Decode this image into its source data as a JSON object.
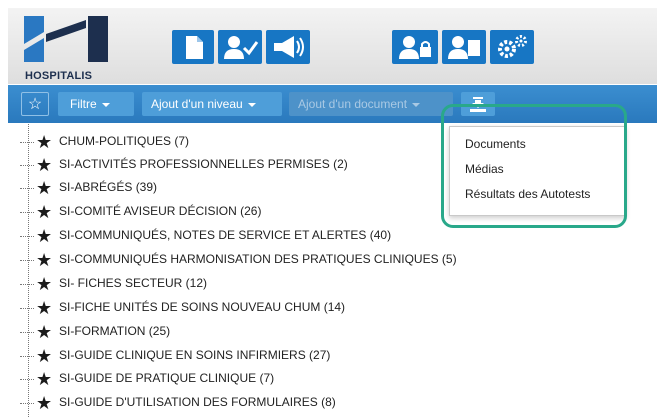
{
  "header": {
    "logo_text": "HOSPITALIS",
    "toolbar_icons": [
      {
        "name": "document-icon"
      },
      {
        "name": "user-check-icon"
      },
      {
        "name": "megaphone-icon"
      },
      {
        "name": "user-lock-icon"
      },
      {
        "name": "user-card-icon"
      },
      {
        "name": "settings-gears-icon"
      }
    ]
  },
  "toolbar": {
    "star_icon": "☆",
    "filter_label": "Filtre",
    "add_level_label": "Ajout d'un niveau",
    "add_document_label": "Ajout d'un document",
    "export_icon": "download-icon"
  },
  "tree": {
    "items": [
      {
        "label": "CHUM-POLITIQUES (7)"
      },
      {
        "label": "SI-ACTIVITÉS PROFESSIONNELLES PERMISES (2)"
      },
      {
        "label": "SI-ABRÉGÉS (39)"
      },
      {
        "label": "SI-COMITÉ AVISEUR DÉCISION (26)"
      },
      {
        "label": "SI-COMMUNIQUÉS, NOTES DE SERVICE ET ALERTES (40)"
      },
      {
        "label": "SI-COMMUNIQUÉS HARMONISATION DES PRATIQUES CLINIQUES (5)"
      },
      {
        "label": "SI- FICHES SECTEUR (12)"
      },
      {
        "label": "SI-FICHE UNITÉS DE SOINS NOUVEAU CHUM (14)"
      },
      {
        "label": "SI-FORMATION (25)"
      },
      {
        "label": "SI-GUIDE CLINIQUE EN SOINS INFIRMIERS (27)"
      },
      {
        "label": "SI-GUIDE DE PRATIQUE CLINIQUE (7)"
      },
      {
        "label": "SI-GUIDE D'UTILISATION DES FORMULAIRES (8)"
      }
    ]
  },
  "dropdown": {
    "items": [
      {
        "label": "Documents"
      },
      {
        "label": "Médias"
      },
      {
        "label": "Résultats des Autotests"
      }
    ]
  },
  "colors": {
    "toolbar_blue": "#2a79bd",
    "icon_blue": "#1776c4",
    "highlight_green": "#29a88a"
  }
}
